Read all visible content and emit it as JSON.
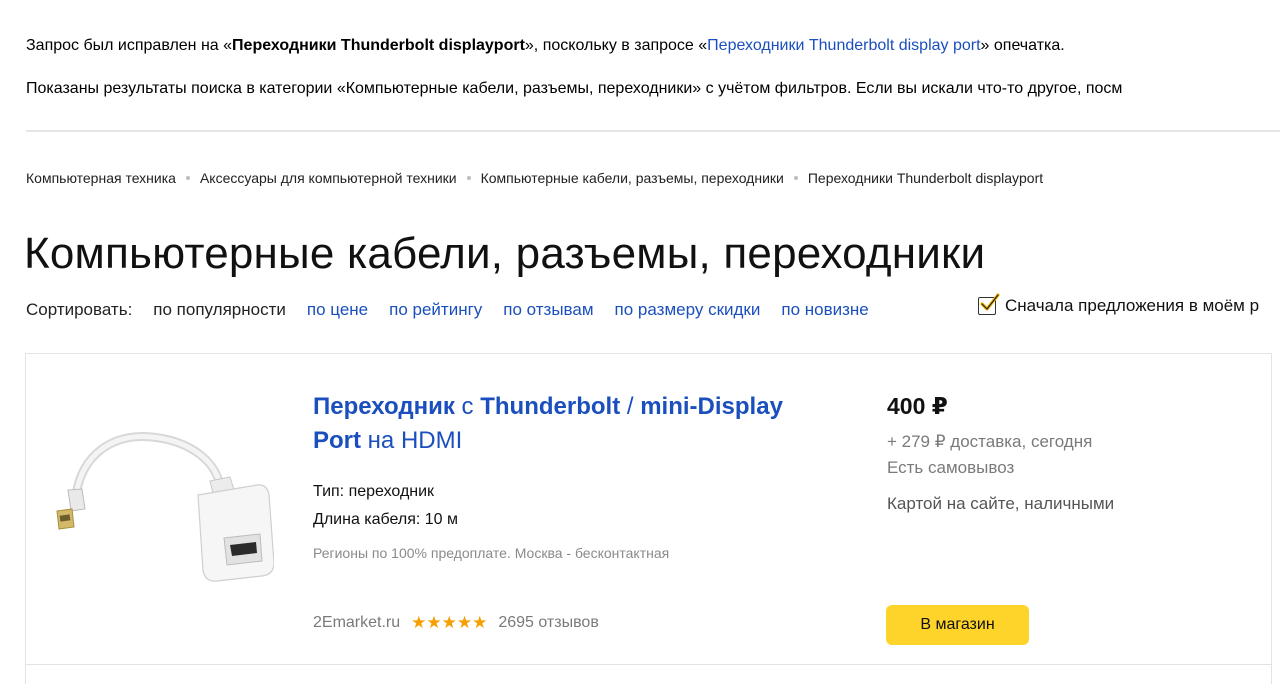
{
  "notices": {
    "line1": {
      "prefix": "Запрос был исправлен на «",
      "corrected_query": "Переходники Thunderbolt displayport",
      "middle": "», поскольку в запросе «",
      "original_query": "Переходники Thunderbolt display port",
      "suffix": "» опечатка."
    },
    "line2": "Показаны результаты поиска в категории «Компьютерные кабели, разъемы, переходники» с учётом фильтров. Если вы искали что-то другое, посм"
  },
  "breadcrumb": [
    "Компьютерная техника",
    "Аксессуары для компьютерной техники",
    "Компьютерные кабели, разъемы, переходники",
    "Переходники Thunderbolt displayport"
  ],
  "page_title": "Компьютерные кабели, разъемы, переходники",
  "sort": {
    "label": "Сортировать:",
    "options": [
      "по популярности",
      "по цене",
      "по рейтингу",
      "по отзывам",
      "по размеру скидки",
      "по новизне"
    ],
    "active_index": 0
  },
  "region_filter": {
    "label": "Сначала предложения в моём р",
    "checked": true
  },
  "product": {
    "title_parts": [
      {
        "text": "Переходник",
        "bold": true
      },
      {
        "text": " с ",
        "bold": false
      },
      {
        "text": "Thunderbolt",
        "bold": true
      },
      {
        "text": " / ",
        "bold": false
      },
      {
        "text": "mini-Display Port",
        "bold": true
      },
      {
        "text": " на HDMI",
        "bold": false
      }
    ],
    "spec_type": "Тип: переходник",
    "spec_length": "Длина кабеля: 10 м",
    "regions_note": "Регионы по 100% предоплате. Москва - бесконтактная",
    "shop_name": "2Emarket.ru",
    "stars": "★★★★★",
    "rating": 5,
    "reviews": "2695 отзывов",
    "price": "400 ₽",
    "delivery": "+ 279 ₽ доставка, сегодня",
    "pickup": "Есть самовывоз",
    "payment": "Картой на сайте, наличными",
    "button_label": "В магазин"
  },
  "colors": {
    "link": "#1a4fbd",
    "button": "#fed42b",
    "stars": "#f5a000",
    "muted": "#7a7a7a"
  }
}
